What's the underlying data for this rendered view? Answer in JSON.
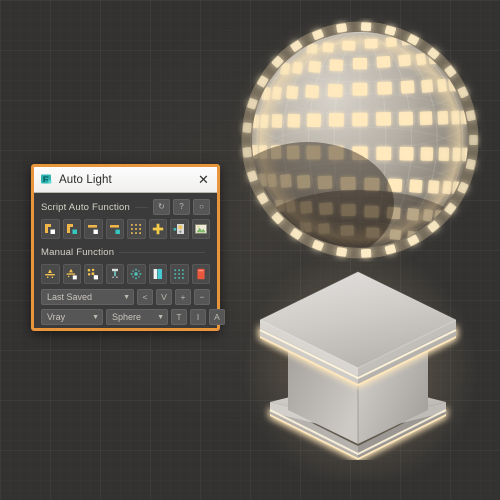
{
  "viewport": {
    "background_color": "#333231",
    "objects": [
      {
        "name": "faceted-light-sphere",
        "label": "Faceted emissive sphere",
        "base_color": "#b9b3a9",
        "emissive_color": "#ffe6b8"
      },
      {
        "name": "lit-pedestal",
        "label": "Isometric pedestal with light strips",
        "base_color": "#c9c6c1",
        "emissive_color": "#ffe3ae"
      }
    ]
  },
  "dialog": {
    "title": "Auto Light",
    "app_icon": "auto-light-icon",
    "close_label": "✕",
    "border_color": "#e8953c",
    "sections": [
      {
        "label": "Script Auto Function",
        "mini_buttons": [
          {
            "name": "refresh-button",
            "glyph": "↻"
          },
          {
            "name": "help-button",
            "glyph": "?"
          },
          {
            "name": "settings-button",
            "glyph": "○"
          }
        ],
        "icons": [
          {
            "name": "corner-light-white-icon",
            "accent": "#f0b64a",
            "chip": "#ffffff"
          },
          {
            "name": "corner-light-teal-icon",
            "accent": "#f0b64a",
            "chip": "#35c8c0"
          },
          {
            "name": "bar-light-white-icon",
            "accent": "#f0b64a",
            "chip": "#ffffff"
          },
          {
            "name": "bar-light-teal-icon",
            "accent": "#f0b64a",
            "chip": "#35c8c0"
          },
          {
            "name": "dot-grid-icon",
            "accent": "#e0b258",
            "chip": "#e0b258"
          },
          {
            "name": "add-plus-icon",
            "accent": "#f5cb4a",
            "chip": "#f5cb4a"
          },
          {
            "name": "light-card-icon",
            "accent": "#e8c96b",
            "chip": "#d9d9d9"
          },
          {
            "name": "image-preview-icon",
            "accent": "#8fc470",
            "chip": "#e7e2c6"
          }
        ]
      },
      {
        "label": "Manual Function",
        "mini_buttons": [],
        "icons": [
          {
            "name": "point-light-icon",
            "accent": "#f2c martian",
            "chip": "#f2c14e"
          },
          {
            "name": "point-light-white-icon",
            "accent": "#f2c14e",
            "chip": "#ffffff"
          },
          {
            "name": "multi-light-icon",
            "accent": "#f2c14e",
            "chip": "#ffffff"
          },
          {
            "name": "light-tube-icon",
            "accent": "#7fd4cf",
            "chip": "#dedede"
          },
          {
            "name": "dotted-cross-icon",
            "accent": "#4fc4bd",
            "chip": "#4fc4bd"
          },
          {
            "name": "panel-light-icon",
            "accent": "#49c9d1",
            "chip": "#f2f2f2"
          },
          {
            "name": "teal-dot-grid-icon",
            "accent": "#4fb7ae",
            "chip": "#4fb7ae"
          },
          {
            "name": "red-panel-icon",
            "accent": "#e8563c",
            "chip": "#e8563c"
          }
        ]
      }
    ],
    "controls": {
      "preset_dropdown": {
        "name": "preset-dropdown",
        "value": "Last Saved"
      },
      "preset_buttons": [
        {
          "name": "preset-prev-button",
          "label": "<"
        },
        {
          "name": "preset-down-button",
          "label": "V"
        },
        {
          "name": "preset-add-button",
          "label": "+"
        },
        {
          "name": "preset-remove-button",
          "label": "−"
        }
      ],
      "renderer_dropdown": {
        "name": "renderer-dropdown",
        "value": "Vray"
      },
      "shape_dropdown": {
        "name": "shape-dropdown",
        "value": "Sphere"
      },
      "mode_buttons": [
        {
          "name": "mode-t-button",
          "label": "T"
        },
        {
          "name": "mode-i-button",
          "label": "I"
        },
        {
          "name": "mode-a-button",
          "label": "A"
        }
      ]
    }
  }
}
